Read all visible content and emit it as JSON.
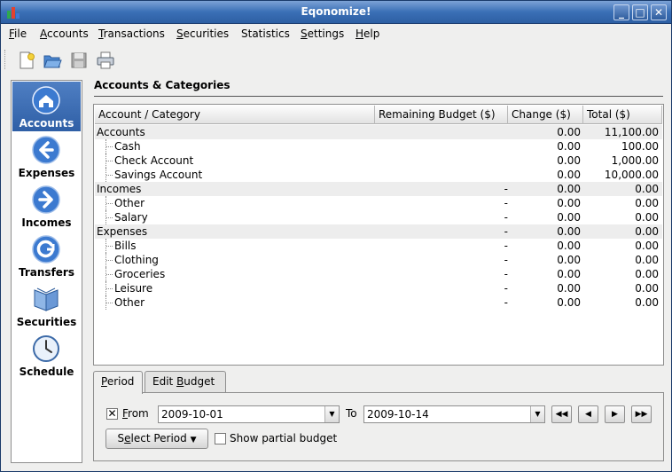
{
  "window": {
    "title": "Eqonomize!",
    "controls": [
      "_",
      "□",
      "✕"
    ]
  },
  "menubar": {
    "items": [
      {
        "first": "F",
        "rest": "ile"
      },
      {
        "first": "A",
        "rest": "ccounts"
      },
      {
        "first": "T",
        "rest": "ransactions"
      },
      {
        "first": "S",
        "rest": "ecurities"
      },
      {
        "first": "",
        "rest": "Statistics"
      },
      {
        "first": "S",
        "rest": "ettings"
      },
      {
        "first": "H",
        "rest": "elp"
      }
    ]
  },
  "toolbar": {
    "buttons": [
      "new-file-icon",
      "open-folder-icon",
      "save-icon",
      "print-icon"
    ]
  },
  "sidebar": {
    "items": [
      {
        "label": "Accounts",
        "icon": "home-icon",
        "active": true
      },
      {
        "label": "Expenses",
        "icon": "arrow-left-icon",
        "active": false
      },
      {
        "label": "Incomes",
        "icon": "arrow-right-icon",
        "active": false
      },
      {
        "label": "Transfers",
        "icon": "transfer-icon",
        "active": false
      },
      {
        "label": "Securities",
        "icon": "book-icon",
        "active": false
      },
      {
        "label": "Schedule",
        "icon": "clock-icon",
        "active": false
      }
    ]
  },
  "main": {
    "title": "Accounts & Categories",
    "table": {
      "columns": [
        "Account / Category",
        "Remaining Budget ($)",
        "Change ($)",
        "Total ($)"
      ],
      "rows": [
        {
          "name": "Accounts",
          "level": 0,
          "remaining": "",
          "change": "0.00",
          "total": "11,100.00"
        },
        {
          "name": "Cash",
          "level": 1,
          "remaining": "",
          "change": "0.00",
          "total": "100.00"
        },
        {
          "name": "Check Account",
          "level": 1,
          "remaining": "",
          "change": "0.00",
          "total": "1,000.00"
        },
        {
          "name": "Savings Account",
          "level": 1,
          "remaining": "",
          "change": "0.00",
          "total": "10,000.00"
        },
        {
          "name": "Incomes",
          "level": 0,
          "remaining": "-",
          "change": "0.00",
          "total": "0.00"
        },
        {
          "name": "Other",
          "level": 1,
          "remaining": "-",
          "change": "0.00",
          "total": "0.00"
        },
        {
          "name": "Salary",
          "level": 1,
          "remaining": "-",
          "change": "0.00",
          "total": "0.00"
        },
        {
          "name": "Expenses",
          "level": 0,
          "remaining": "-",
          "change": "0.00",
          "total": "0.00"
        },
        {
          "name": "Bills",
          "level": 1,
          "remaining": "-",
          "change": "0.00",
          "total": "0.00"
        },
        {
          "name": "Clothing",
          "level": 1,
          "remaining": "-",
          "change": "0.00",
          "total": "0.00"
        },
        {
          "name": "Groceries",
          "level": 1,
          "remaining": "-",
          "change": "0.00",
          "total": "0.00"
        },
        {
          "name": "Leisure",
          "level": 1,
          "remaining": "-",
          "change": "0.00",
          "total": "0.00"
        },
        {
          "name": "Other",
          "level": 1,
          "remaining": "-",
          "change": "0.00",
          "total": "0.00"
        }
      ]
    }
  },
  "tabs": [
    {
      "first": "P",
      "rest": "eriod",
      "active": true
    },
    {
      "before": "Edit ",
      "first": "B",
      "rest": "udget",
      "active": false
    }
  ],
  "period": {
    "from_checked": true,
    "from_label_first": "F",
    "from_label_rest": "rom",
    "from_value": "2009-10-01",
    "to_label": "To",
    "to_value": "2009-10-14",
    "select_period_before": "S",
    "select_period_u": "e",
    "select_period_rest": "lect Period",
    "show_partial_label": "Show partial budget",
    "show_partial_checked": false
  },
  "colors": {
    "titlebar": "#3a6fb6",
    "sidebar_active": "#3f6fb5",
    "alt_row": "#ededed"
  }
}
